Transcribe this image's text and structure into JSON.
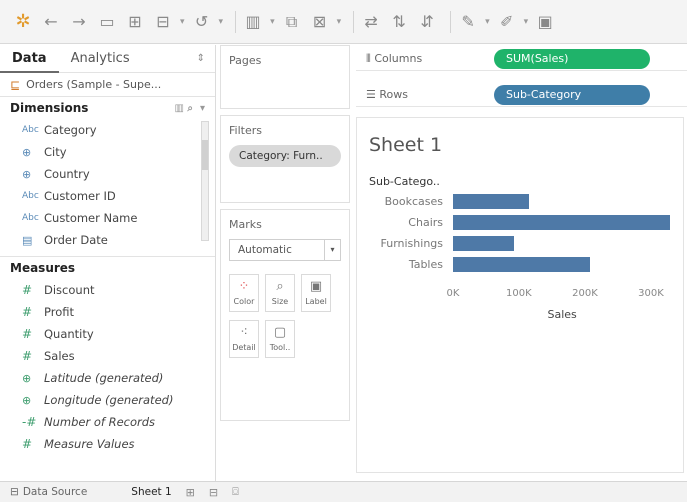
{
  "toolbar": {
    "icons": [
      "tableau-logo-icon",
      "back-arrow-icon",
      "forward-arrow-icon",
      "save-icon",
      "new-datasource-icon",
      "new-sheet-icon",
      "undo-icon",
      "show-me-icon",
      "duplicate-icon",
      "clear-icon",
      "swap-icon",
      "sort-ascending-icon",
      "sort-descending-icon",
      "highlight-icon",
      "group-icon",
      "label-icon"
    ]
  },
  "datapane": {
    "tabs": [
      "Data",
      "Analytics"
    ],
    "datasource": "Orders (Sample - Supe...",
    "dimensions_title": "Dimensions",
    "dimensions": [
      {
        "label": "Category",
        "type": "Abc"
      },
      {
        "label": "City",
        "type": "geo"
      },
      {
        "label": "Country",
        "type": "geo"
      },
      {
        "label": "Customer ID",
        "type": "Abc"
      },
      {
        "label": "Customer Name",
        "type": "Abc"
      },
      {
        "label": "Order Date",
        "type": "date"
      }
    ],
    "measures_title": "Measures",
    "measures": [
      {
        "label": "Discount",
        "type": "#"
      },
      {
        "label": "Profit",
        "type": "#"
      },
      {
        "label": "Quantity",
        "type": "#"
      },
      {
        "label": "Sales",
        "type": "#"
      },
      {
        "label": "Latitude (generated)",
        "type": "geo"
      },
      {
        "label": "Longitude (generated)",
        "type": "geo"
      },
      {
        "label": "Number of Records",
        "type": "#"
      },
      {
        "label": "Measure Values",
        "type": "#"
      }
    ]
  },
  "shelves": {
    "pages_title": "Pages",
    "filters_title": "Filters",
    "filter_pill": "Category: Furn..",
    "marks_title": "Marks",
    "marks_type": "Automatic",
    "mark_buttons": [
      "Color",
      "Size",
      "Label",
      "Detail",
      "Tool.."
    ]
  },
  "columns": {
    "label": "Columns",
    "pill": "SUM(Sales)"
  },
  "rows": {
    "label": "Rows",
    "pill": "Sub-Category"
  },
  "viz": {
    "sheet_title": "Sheet 1",
    "row_header": "Sub-Catego..",
    "axis_title": "Sales"
  },
  "chart_data": {
    "type": "bar",
    "orientation": "horizontal",
    "title": "Sheet 1",
    "ylabel": "Sub-Catego..",
    "xlabel": "Sales",
    "categories": [
      "Bookcases",
      "Chairs",
      "Furnishings",
      "Tables"
    ],
    "values": [
      114880,
      328449,
      91705,
      206966
    ],
    "xlim": [
      0,
      330000
    ],
    "ticks": [
      "0K",
      "100K",
      "200K",
      "300K"
    ],
    "tick_values": [
      0,
      100000,
      200000,
      300000
    ],
    "bar_color": "#4e79a7"
  },
  "bottombar": {
    "datasource_label": "Data Source",
    "sheet_label": "Sheet 1"
  },
  "colors": {
    "columns_pill": "#1fb36a",
    "rows_pill": "#3f7ea8"
  }
}
